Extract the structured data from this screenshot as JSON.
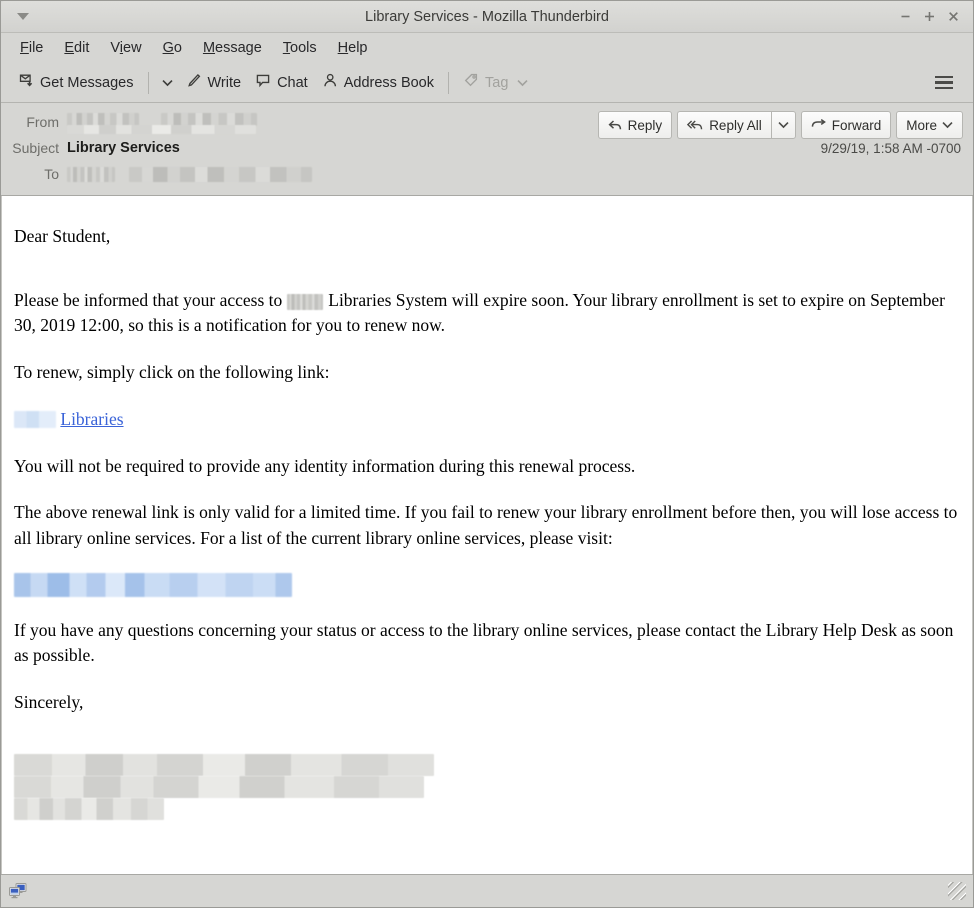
{
  "window": {
    "title": "Library Services - Mozilla Thunderbird",
    "minimize_label": "−",
    "maximize_label": "+",
    "close_label": "×"
  },
  "menubar": {
    "items": [
      {
        "label": "File",
        "mnemonic": "F",
        "rest": "ile"
      },
      {
        "label": "Edit",
        "mnemonic": "E",
        "rest": "dit"
      },
      {
        "label": "View",
        "mnemonic": "V",
        "rest": "iew",
        "pre": ""
      },
      {
        "label": "Go",
        "mnemonic": "G",
        "rest": "o"
      },
      {
        "label": "Message",
        "mnemonic": "M",
        "rest": "essage"
      },
      {
        "label": "Tools",
        "mnemonic": "T",
        "rest": "ools"
      },
      {
        "label": "Help",
        "mnemonic": "H",
        "rest": "elp"
      }
    ]
  },
  "toolbar": {
    "get_messages": "Get Messages",
    "write": "Write",
    "chat": "Chat",
    "address_book": "Address Book",
    "tag": "Tag",
    "tag_disabled": true
  },
  "message_header": {
    "from_label": "From",
    "from_value_redacted": true,
    "subject_label": "Subject",
    "subject_value": "Library Services",
    "to_label": "To",
    "to_value_redacted": true,
    "date": "9/29/19, 1:58 AM -0700",
    "actions": {
      "reply": "Reply",
      "reply_all": "Reply All",
      "forward": "Forward",
      "more": "More"
    }
  },
  "body": {
    "greeting": "Dear Student,",
    "paragraph_1_before": "Please be informed that your access to",
    "paragraph_1_after": "Libraries System will expire soon. Your library enrollment is set to expire on September 30, 2019 12:00, so this is a notification for you to renew now.",
    "paragraph_2": "To renew, simply click on the following link:",
    "link_text": "Libraries",
    "paragraph_3": "You will not be required to provide any identity information during this renewal process.",
    "paragraph_4": "The above renewal link is only valid for a limited time. If you fail to renew your library enrollment before then, you will lose access to all library online services. For a list of the current library online services, please visit:",
    "paragraph_5": "If you have any questions concerning your status or access to the library online services, please contact the Library Help Desk as soon as possible.",
    "closing": "Sincerely,",
    "signature_redacted": true
  },
  "statusbar": {
    "connection_icon": "network-status-icon"
  },
  "colors": {
    "chrome": "#d6d6d3",
    "link": "#3a63d8",
    "text": "#000000",
    "title_text": "#3b3b38",
    "status_icon_blue": "#3a5fbf"
  }
}
